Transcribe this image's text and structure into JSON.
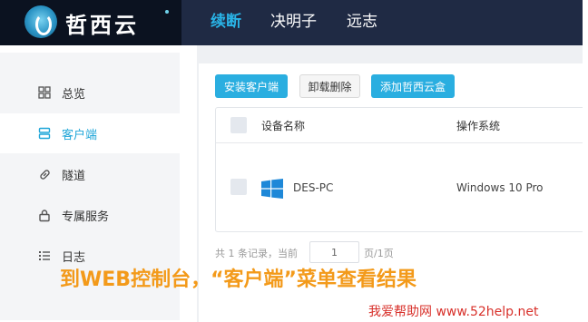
{
  "header": {
    "logo_text": "哲西云",
    "nav": [
      {
        "label": "续断",
        "active": true
      },
      {
        "label": "决明子",
        "active": false
      },
      {
        "label": "远志",
        "active": false
      }
    ]
  },
  "sidebar": {
    "items": [
      {
        "label": "总览",
        "icon": "grid-icon",
        "active": false
      },
      {
        "label": "客户端",
        "icon": "client-icon",
        "active": true
      },
      {
        "label": "隧道",
        "icon": "link-icon",
        "active": false
      },
      {
        "label": "专属服务",
        "icon": "lock-icon",
        "active": false
      },
      {
        "label": "日志",
        "icon": "list-icon",
        "active": false
      }
    ]
  },
  "toolbar": {
    "install_label": "安装客户端",
    "uninstall_label": "卸载删除",
    "add_box_label": "添加哲西云盒"
  },
  "table": {
    "headers": [
      "设备名称",
      "操作系统"
    ],
    "rows": [
      {
        "device": "DES-PC",
        "os": "Windows 10 Pro",
        "icon": "windows-icon"
      }
    ]
  },
  "pager": {
    "summary": "共 1 条记录，当前",
    "page_value": "1",
    "suffix": "页/1页"
  },
  "caption": "到WEB控制台，“客户端”菜单查看结果",
  "watermark": "我爱帮助网 www.52help.net",
  "colors": {
    "accent": "#2aaee0",
    "header_bg": "#1f2a44",
    "caption": "#f39a1a",
    "watermark": "#d8302a"
  }
}
